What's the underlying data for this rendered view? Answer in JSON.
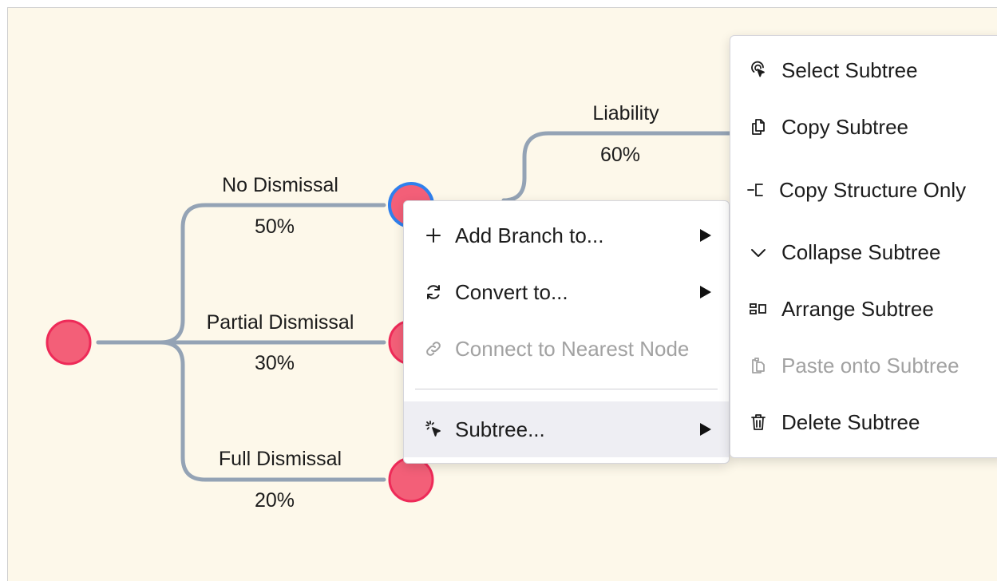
{
  "tree": {
    "branches": [
      {
        "name": "No Dismissal",
        "probability": "50%"
      },
      {
        "name": "Partial Dismissal",
        "probability": "30%"
      },
      {
        "name": "Full Dismissal",
        "probability": "20%"
      },
      {
        "name": "Liability",
        "probability": "60%"
      }
    ],
    "colors": {
      "canvas": "#fdf8ea",
      "edge": "#94a3b5",
      "node_fill": "#f35f78",
      "node_stroke": "#ee2a58",
      "selected_stroke": "#2f80ed"
    }
  },
  "context_menu": {
    "items": [
      {
        "label": "Add Branch to...",
        "icon": "plus-icon",
        "has_submenu": true,
        "disabled": false
      },
      {
        "label": "Convert to...",
        "icon": "refresh-icon",
        "has_submenu": true,
        "disabled": false
      },
      {
        "label": "Connect to Nearest Node",
        "icon": "link-icon",
        "has_submenu": false,
        "disabled": true
      },
      {
        "label": "Subtree...",
        "icon": "cursor-click-icon",
        "has_submenu": true,
        "disabled": false,
        "highlighted": true
      }
    ]
  },
  "subtree_menu": {
    "items": [
      {
        "label": "Select Subtree",
        "icon": "pointer-select-icon",
        "disabled": false
      },
      {
        "label": "Copy Subtree",
        "icon": "copy-icon",
        "disabled": false
      },
      {
        "label": "Copy Structure Only",
        "icon": "structure-icon",
        "disabled": false
      },
      {
        "label": "Collapse Subtree",
        "icon": "chevron-down-icon",
        "disabled": false
      },
      {
        "label": "Arrange Subtree",
        "icon": "arrange-icon",
        "disabled": false
      },
      {
        "label": "Paste onto Subtree",
        "icon": "paste-icon",
        "disabled": true
      },
      {
        "label": "Delete Subtree",
        "icon": "trash-icon",
        "disabled": false
      }
    ]
  }
}
